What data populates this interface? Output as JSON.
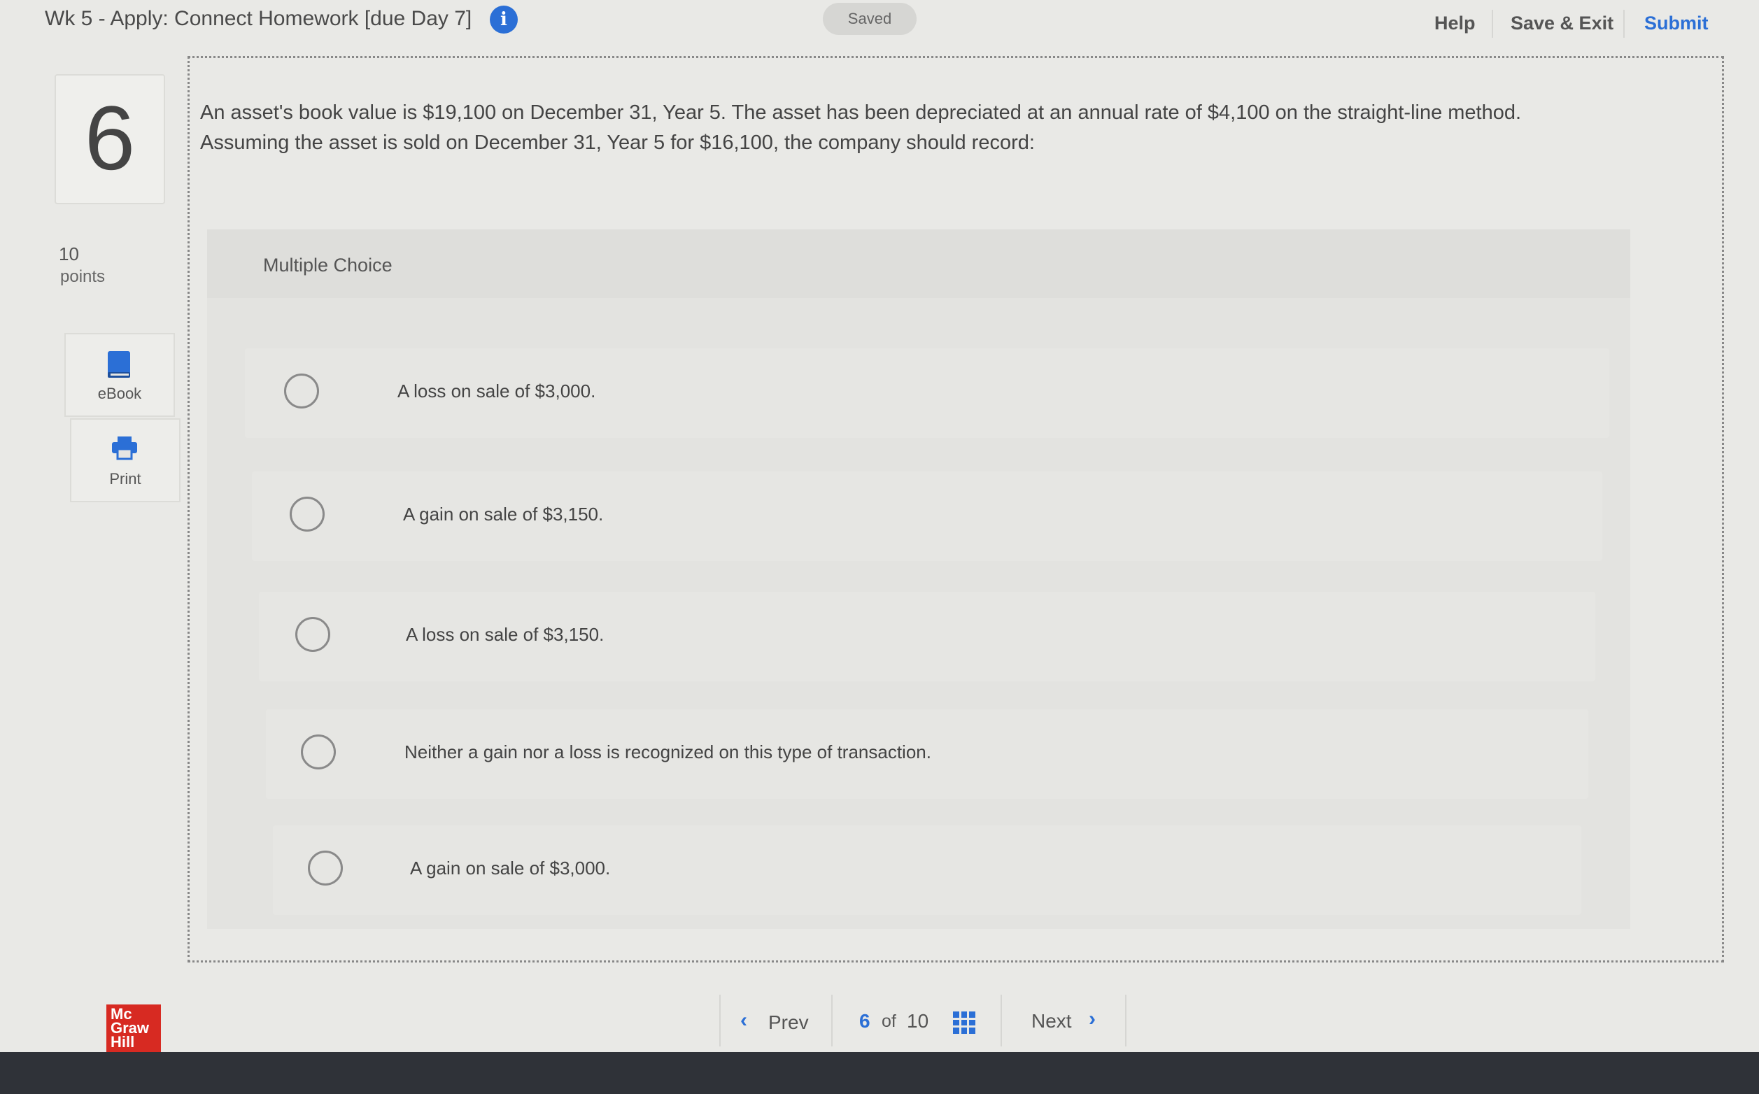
{
  "header": {
    "assignment_title": "Wk 5 - Apply: Connect Homework [due Day 7]",
    "info_glyph": "i",
    "saved_status": "Saved",
    "help_label": "Help",
    "save_exit_label": "Save & Exit",
    "submit_label": "Submit"
  },
  "question": {
    "number": "6",
    "points_value": "10",
    "points_label": "points",
    "tools": {
      "ebook_label": "eBook",
      "print_label": "Print"
    },
    "prompt_line1": "An asset's book value is $19,100 on December 31, Year 5. The asset has been depreciated at an annual rate of $4,100 on the straight-line method.",
    "prompt_line2": "Assuming the asset is sold on December 31, Year 5 for $16,100, the company should record:",
    "type_label": "Multiple Choice",
    "options": [
      "A loss on sale of $3,000.",
      "A gain on sale of $3,150.",
      "A loss on sale of $3,150.",
      "Neither a gain nor a loss is recognized on this type of transaction.",
      "A gain on sale of $3,000."
    ]
  },
  "footer": {
    "logo": {
      "line1": "Mc",
      "line2": "Graw",
      "line3": "Hill"
    },
    "prev_label": "Prev",
    "current_page": "6",
    "of_label": "of",
    "total_pages": "10",
    "next_label": "Next"
  },
  "colors": {
    "accent": "#2b6fd6",
    "brand_red": "#d72a22",
    "background": "#e9e9e6"
  }
}
